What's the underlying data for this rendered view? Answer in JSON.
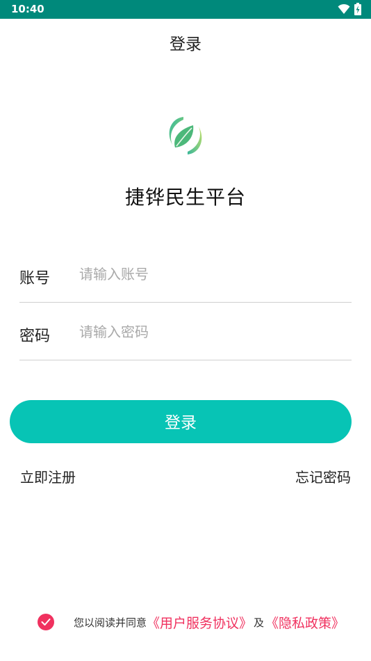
{
  "status_bar": {
    "time": "10:40",
    "icons": [
      "wifi-icon",
      "battery-charging-icon"
    ]
  },
  "header": {
    "title": "登录"
  },
  "app": {
    "name": "捷铧民生平台",
    "logo": "leaf-logo"
  },
  "form": {
    "account": {
      "label": "账号",
      "placeholder": "请输入账号",
      "value": ""
    },
    "password": {
      "label": "密码",
      "placeholder": "请输入密码",
      "value": ""
    }
  },
  "actions": {
    "login_label": "登录",
    "register_label": "立即注册",
    "forgot_label": "忘记密码"
  },
  "agreement": {
    "checked": true,
    "prefix": "您以阅读并同意",
    "terms_link": "《用户服务协议》",
    "and": "及",
    "privacy_link": "《隐私政策》"
  },
  "colors": {
    "status_bar": "#00897b",
    "primary": "#07c4b5",
    "accent": "#f0315f"
  }
}
